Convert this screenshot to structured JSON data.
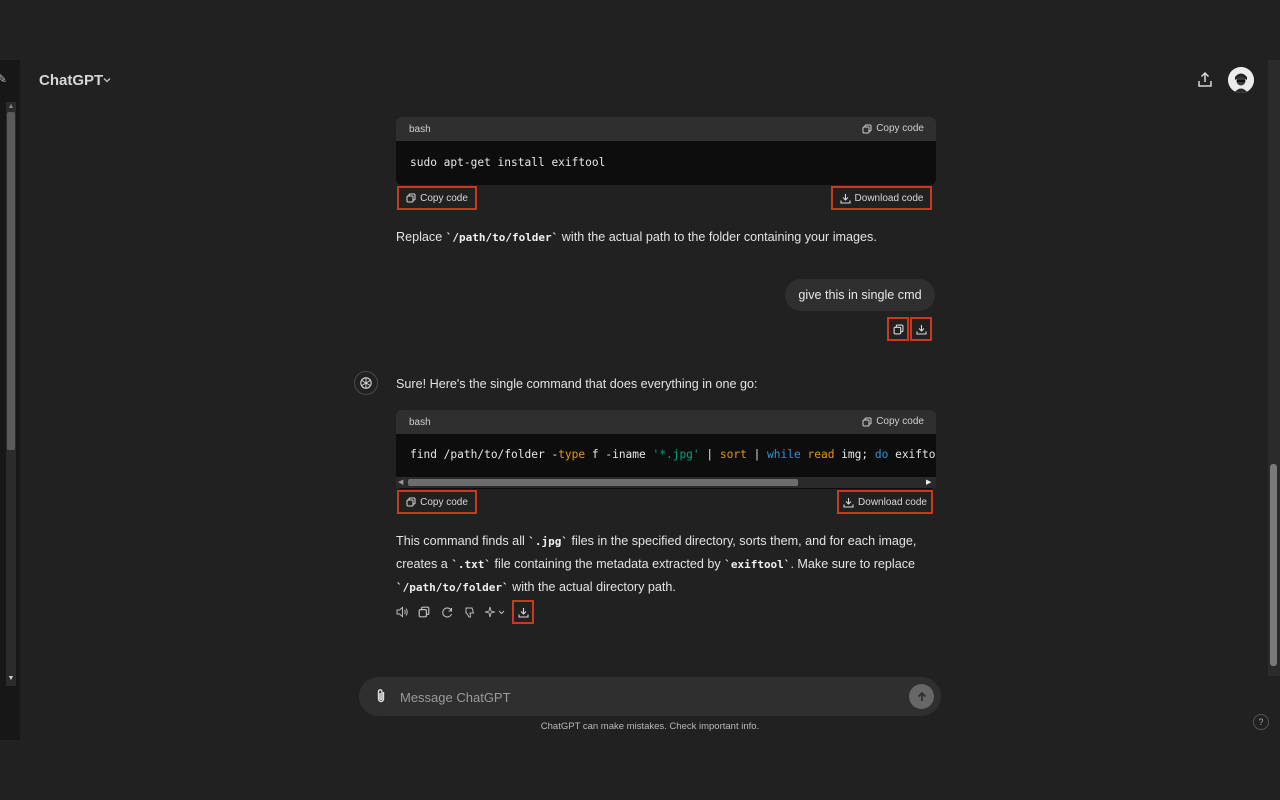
{
  "header": {
    "title": "ChatGPT"
  },
  "messages": {
    "block1": {
      "lang": "bash",
      "copy_label": "Copy code",
      "code": "sudo apt-get install exiftool",
      "btn_copy": "Copy code",
      "btn_download": "Download code"
    },
    "para1": {
      "before": "Replace ",
      "code": "`/path/to/folder`",
      "after": " with the actual path to the folder containing your images."
    },
    "user_msg": "give this in single cmd",
    "assistant_intro": "Sure! Here's the single command that does everything in one go:",
    "block2": {
      "lang": "bash",
      "copy_label": "Copy code",
      "code_tokens": [
        {
          "t": "find /path/to/folder -",
          "c": "plain"
        },
        {
          "t": "type",
          "c": "kw"
        },
        {
          "t": " f -iname ",
          "c": "plain"
        },
        {
          "t": "'*.jpg'",
          "c": "str"
        },
        {
          "t": " | ",
          "c": "plain"
        },
        {
          "t": "sort",
          "c": "kw"
        },
        {
          "t": " | ",
          "c": "plain"
        },
        {
          "t": "while",
          "c": "blue"
        },
        {
          "t": " ",
          "c": "plain"
        },
        {
          "t": "read",
          "c": "kw"
        },
        {
          "t": " img; ",
          "c": "plain"
        },
        {
          "t": "do",
          "c": "blue"
        },
        {
          "t": " exiftool ",
          "c": "plain"
        },
        {
          "t": "\"$",
          "c": "str"
        }
      ],
      "btn_copy": "Copy code",
      "btn_download": "Download code"
    },
    "para2": {
      "l1a": "This command finds all ",
      "l1code": "`.jpg`",
      "l1b": " files in the specified directory, sorts them, and for each image,",
      "l2a": "creates a ",
      "l2code": "`.txt`",
      "l2b": " file containing the metadata extracted by ",
      "l2code2": "`exiftool`",
      "l2c": ". Make sure to replace",
      "l3code": "`/path/to/folder`",
      "l3b": " with the actual directory path."
    }
  },
  "composer": {
    "placeholder": "Message ChatGPT",
    "disclaimer": "ChatGPT can make mistakes. Check important info."
  },
  "help": "?",
  "colors": {
    "highlight": "#c8391f",
    "bg": "#212121"
  },
  "icons": [
    "share-icon",
    "copy-icon",
    "download-icon",
    "speaker-icon",
    "regenerate-icon",
    "thumbs-down-icon",
    "sparkle-icon",
    "paperclip-icon",
    "arrow-up-icon",
    "openai-logo-icon",
    "chevron-down-icon"
  ]
}
